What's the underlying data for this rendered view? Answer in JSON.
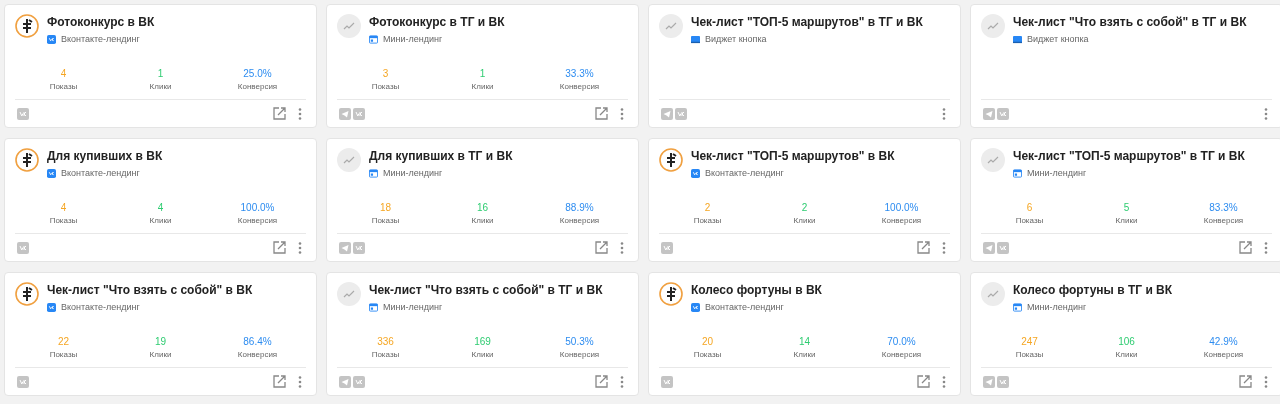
{
  "cards": [
    {
      "avatar": {
        "kind": "logo"
      },
      "title": "Фотоконкурс в ВК",
      "type": {
        "kind": "vk",
        "label": "Вконтакте-лендинг"
      },
      "stats": [
        {
          "value": "4",
          "label": "Показы"
        },
        {
          "value": "1",
          "label": "Клики"
        },
        {
          "value": "25.0%",
          "label": "Конверсия"
        }
      ],
      "channels": [
        {
          "kind": "vk"
        }
      ],
      "open_link": true
    },
    {
      "avatar": {
        "kind": "chart"
      },
      "title": "Фотоконкурс в ТГ и ВК",
      "type": {
        "kind": "mini",
        "label": "Мини-лендинг"
      },
      "stats": [
        {
          "value": "3",
          "label": "Показы"
        },
        {
          "value": "1",
          "label": "Клики"
        },
        {
          "value": "33.3%",
          "label": "Конверсия"
        }
      ],
      "channels": [
        {
          "kind": "tg"
        },
        {
          "kind": "vk"
        }
      ],
      "open_link": true
    },
    {
      "avatar": {
        "kind": "chart"
      },
      "title": "Чек-лист \"ТОП-5 маршрутов\" в ТГ и ВК",
      "type": {
        "kind": "widget",
        "label": "Виджет кнопка"
      },
      "channels": [
        {
          "kind": "tg"
        },
        {
          "kind": "vk"
        }
      ],
      "open_link": false
    },
    {
      "avatar": {
        "kind": "chart"
      },
      "title": "Чек-лист \"Что взять с собой\" в ТГ и ВК",
      "type": {
        "kind": "widget",
        "label": "Виджет кнопка"
      },
      "channels": [
        {
          "kind": "tg"
        },
        {
          "kind": "vk"
        }
      ],
      "open_link": false
    },
    {
      "avatar": {
        "kind": "logo"
      },
      "title": "Для купивших в ВК",
      "type": {
        "kind": "vk",
        "label": "Вконтакте-лендинг"
      },
      "stats": [
        {
          "value": "4",
          "label": "Показы"
        },
        {
          "value": "4",
          "label": "Клики"
        },
        {
          "value": "100.0%",
          "label": "Конверсия"
        }
      ],
      "channels": [
        {
          "kind": "vk"
        }
      ],
      "open_link": true
    },
    {
      "avatar": {
        "kind": "chart"
      },
      "title": "Для купивших в ТГ и ВК",
      "type": {
        "kind": "mini",
        "label": "Мини-лендинг"
      },
      "stats": [
        {
          "value": "18",
          "label": "Показы"
        },
        {
          "value": "16",
          "label": "Клики"
        },
        {
          "value": "88.9%",
          "label": "Конверсия"
        }
      ],
      "channels": [
        {
          "kind": "tg"
        },
        {
          "kind": "vk"
        }
      ],
      "open_link": true
    },
    {
      "avatar": {
        "kind": "logo"
      },
      "title": "Чек-лист \"ТОП-5 маршрутов\" в ВК",
      "type": {
        "kind": "vk",
        "label": "Вконтакте-лендинг"
      },
      "stats": [
        {
          "value": "2",
          "label": "Показы"
        },
        {
          "value": "2",
          "label": "Клики"
        },
        {
          "value": "100.0%",
          "label": "Конверсия"
        }
      ],
      "channels": [
        {
          "kind": "vk"
        }
      ],
      "open_link": true
    },
    {
      "avatar": {
        "kind": "chart"
      },
      "title": "Чек-лист \"ТОП-5 маршрутов\" в ТГ и ВК",
      "type": {
        "kind": "mini",
        "label": "Мини-лендинг"
      },
      "stats": [
        {
          "value": "6",
          "label": "Показы"
        },
        {
          "value": "5",
          "label": "Клики"
        },
        {
          "value": "83.3%",
          "label": "Конверсия"
        }
      ],
      "channels": [
        {
          "kind": "tg"
        },
        {
          "kind": "vk"
        }
      ],
      "open_link": true
    },
    {
      "avatar": {
        "kind": "logo"
      },
      "title": "Чек-лист \"Что взять с собой\" в ВК",
      "type": {
        "kind": "vk",
        "label": "Вконтакте-лендинг"
      },
      "stats": [
        {
          "value": "22",
          "label": "Показы"
        },
        {
          "value": "19",
          "label": "Клики"
        },
        {
          "value": "86.4%",
          "label": "Конверсия"
        }
      ],
      "channels": [
        {
          "kind": "vk"
        }
      ],
      "open_link": true
    },
    {
      "avatar": {
        "kind": "chart"
      },
      "title": "Чек-лист \"Что взять с собой\" в ТГ и ВК",
      "type": {
        "kind": "mini",
        "label": "Мини-лендинг"
      },
      "stats": [
        {
          "value": "336",
          "label": "Показы"
        },
        {
          "value": "169",
          "label": "Клики"
        },
        {
          "value": "50.3%",
          "label": "Конверсия"
        }
      ],
      "channels": [
        {
          "kind": "tg"
        },
        {
          "kind": "vk"
        }
      ],
      "open_link": true
    },
    {
      "avatar": {
        "kind": "logo"
      },
      "title": "Колесо фортуны в ВК",
      "type": {
        "kind": "vk",
        "label": "Вконтакте-лендинг"
      },
      "stats": [
        {
          "value": "20",
          "label": "Показы"
        },
        {
          "value": "14",
          "label": "Клики"
        },
        {
          "value": "70.0%",
          "label": "Конверсия"
        }
      ],
      "channels": [
        {
          "kind": "vk"
        }
      ],
      "open_link": true
    },
    {
      "avatar": {
        "kind": "chart"
      },
      "title": "Колесо фортуны в ТГ и ВК",
      "type": {
        "kind": "mini",
        "label": "Мини-лендинг"
      },
      "stats": [
        {
          "value": "247",
          "label": "Показы"
        },
        {
          "value": "106",
          "label": "Клики"
        },
        {
          "value": "42.9%",
          "label": "Конверсия"
        }
      ],
      "channels": [
        {
          "kind": "tg"
        },
        {
          "kind": "vk"
        }
      ],
      "open_link": true
    }
  ]
}
